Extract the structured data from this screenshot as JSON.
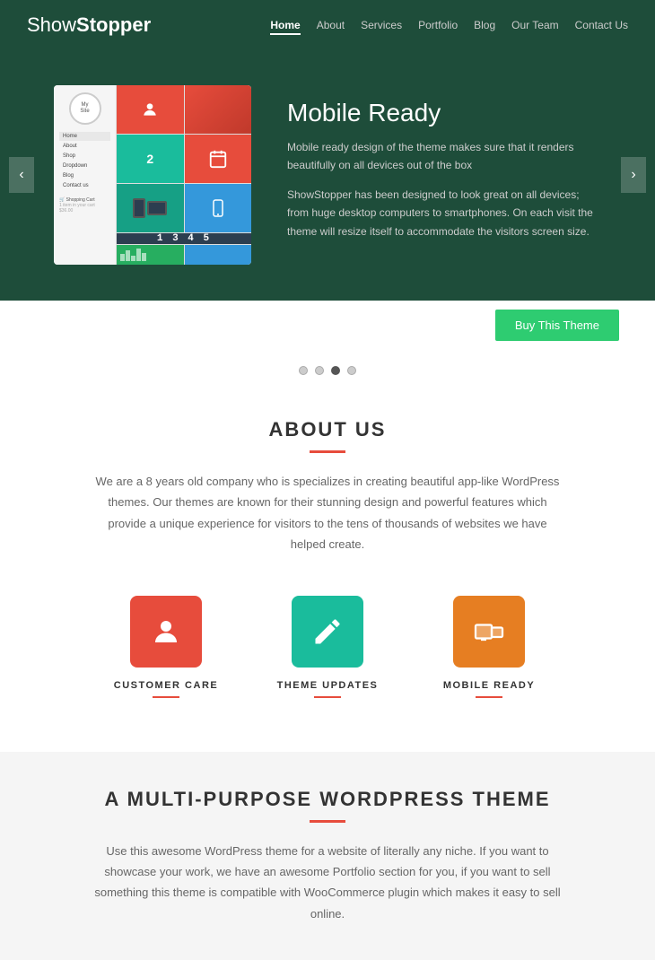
{
  "header": {
    "logo_light": "Show",
    "logo_bold": "Stopper",
    "nav": [
      {
        "label": "Home",
        "active": true
      },
      {
        "label": "About",
        "active": false
      },
      {
        "label": "Services",
        "active": false
      },
      {
        "label": "Portfolio",
        "active": false
      },
      {
        "label": "Blog",
        "active": false
      },
      {
        "label": "Our Team",
        "active": false
      },
      {
        "label": "Contact Us",
        "active": false
      }
    ]
  },
  "hero": {
    "title": "Mobile Ready",
    "para1": "Mobile ready design of the theme makes sure that it renders beautifully on all devices out of the box",
    "para2": "ShowStopper has been designed to look great on all devices; from huge desktop computers to smartphones. On each visit the theme will resize itself to accommodate the visitors screen size.",
    "clock_text": "1 3 4 5",
    "prev_label": "‹",
    "next_label": "›"
  },
  "buy_button": {
    "label": "Buy This Theme"
  },
  "dots": [
    {
      "active": false
    },
    {
      "active": false
    },
    {
      "active": true
    },
    {
      "active": false
    }
  ],
  "about": {
    "title": "ABOUT US",
    "text": "We are a 8 years old company who is specializes in creating beautiful app-like WordPress themes. Our themes are known for their stunning design and powerful features which provide a unique experience for visitors to the tens of thousands of websites we have helped create.",
    "features": [
      {
        "name": "CUSTOMER CARE",
        "icon_type": "person",
        "bg": "icon-red"
      },
      {
        "name": "THEME UPDATES",
        "icon_type": "pen",
        "bg": "icon-teal"
      },
      {
        "name": "MOBILE READY",
        "icon_type": "devices",
        "bg": "icon-orange"
      }
    ]
  },
  "multi": {
    "title": "A MULTI-PURPOSE WORDPRESS THEME",
    "text": "Use this awesome WordPress theme for a website of literally any niche. If you want to showcase your work, we have an awesome Portfolio section for you, if you want to sell something this theme is compatible with WooCommerce plugin which makes it easy to sell online."
  }
}
